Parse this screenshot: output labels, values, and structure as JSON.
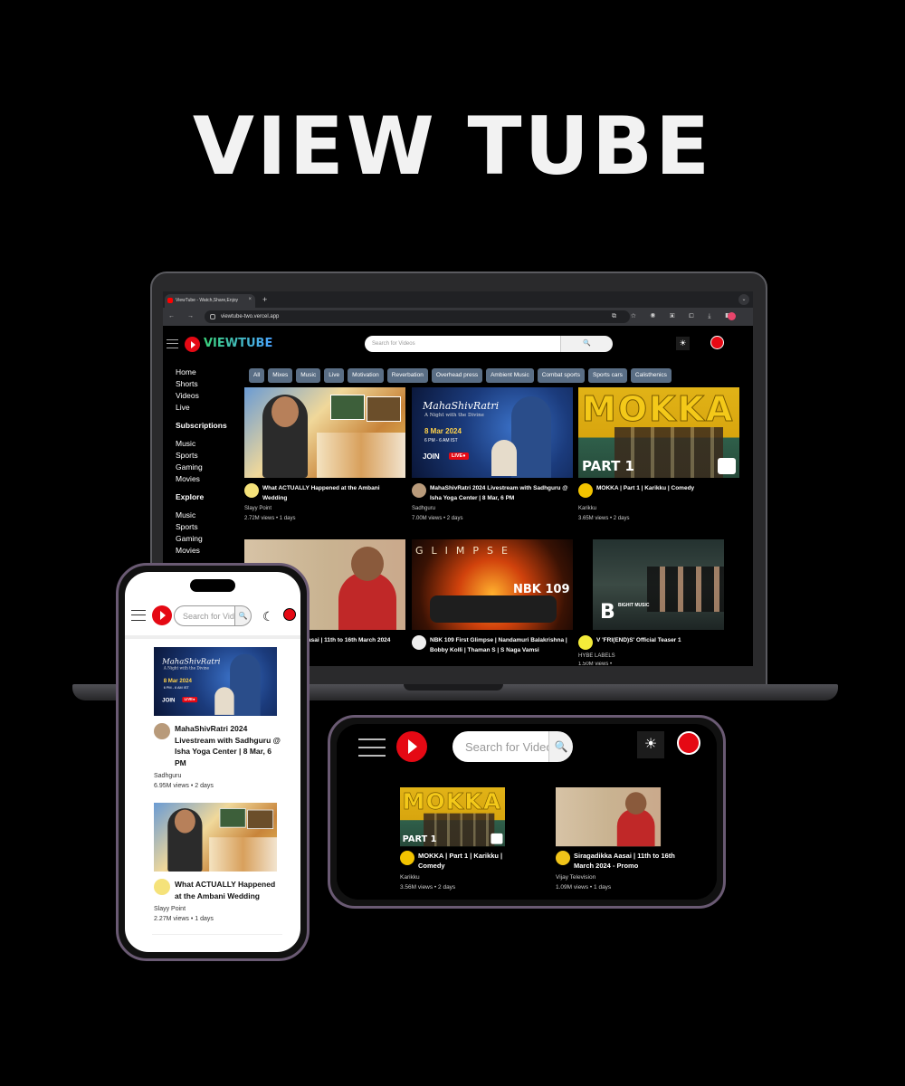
{
  "hero": {
    "title": "VIEW TUBE"
  },
  "browser": {
    "tab_title": "ViewTube - Watch,Share,Enjoy",
    "tab_close": "×",
    "new_tab": "+",
    "url": "viewtube-two.vercel.app",
    "nav_buttons": "← → ⟳",
    "extension_icons": "⧉ ☆ ◉ ▣ ⧠ ⤓ ◧"
  },
  "app": {
    "brand": "VIEWTUBE",
    "search_placeholder": "Search for Videos",
    "search_button": "🔍",
    "theme_light_icon": "☀",
    "theme_dark_icon": "☾",
    "sidebar": {
      "main": [
        "Home",
        "Shorts",
        "Videos",
        "Live"
      ],
      "subscriptions_header": "Subscriptions",
      "subscriptions": [
        "Music",
        "Sports",
        "Gaming",
        "Movies"
      ],
      "explore_header": "Explore",
      "explore": [
        "Music",
        "Sports",
        "Gaming",
        "Movies"
      ]
    },
    "chips": [
      "All",
      "Mixes",
      "Music",
      "Live",
      "Motivation",
      "Reverbation",
      "Overhead press",
      "Ambient Music",
      "Combat sports",
      "Sports cars",
      "Calisthenics"
    ]
  },
  "videos": {
    "ambani": {
      "title": "What ACTUALLY Happened at the Ambani Wedding",
      "channel": "Slayy Point",
      "views": "2.72M views •",
      "age": "1 days",
      "views_mobile": "2.27M views •"
    },
    "shivratri": {
      "title": "MahaShivRatri 2024 Livestream with Sadhguru @ Isha Yoga Center | 8 Mar, 6 PM",
      "channel": "Sadhguru",
      "views": "7.00M views •",
      "age": "2 days",
      "views_mobile": "6.95M views •",
      "thumb_script": "MahaShivRatri",
      "thumb_sub": "A Night with the Divine",
      "thumb_date": "8 Mar 2024",
      "thumb_time": "6 PM - 6 AM IST",
      "thumb_join": "JOIN",
      "thumb_live": "LIVE●"
    },
    "mokka": {
      "title": "MOKKA | Part 1 | Karikku | Comedy",
      "channel": "Karikku",
      "views": "3.65M views •",
      "age": "2 days",
      "views_mobile": "3.56M views •",
      "thumb_big": "MOKKA",
      "thumb_part": "PART 1"
    },
    "siragadikka": {
      "title_partial": "asai | 11th to 16th March 2024",
      "title": "Siragadikka Aasai | 11th to 16th March 2024 - Promo",
      "channel": "Vijay Television",
      "views": "1.09M views •",
      "age": "1 days"
    },
    "nbk": {
      "title": "NBK 109 First Glimpse | Nandamuri Balakrishna | Bobby Kolli | Thaman S | S Naga Vamsi",
      "thumb_glimpse": "GLIMPSE",
      "thumb_nbk": "NBK 109"
    },
    "v": {
      "title": "V 'FRI(END)S' Official Teaser 1",
      "channel": "HYBE LABELS",
      "views_cut": "1.50M views •",
      "thumb_b": "B",
      "thumb_bm": "BIGHIT MUSIC"
    }
  }
}
